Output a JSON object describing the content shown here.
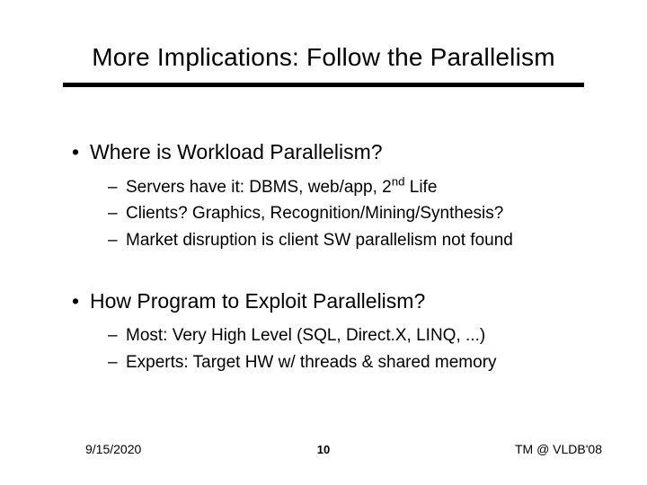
{
  "title": "More Implications: Follow the Parallelism",
  "bullets": [
    {
      "text": "Where is Workload Parallelism?",
      "sub": [
        {
          "pre": "Servers have it: DBMS, web/app, 2",
          "sup": "nd",
          "post": " Life"
        },
        {
          "pre": "Clients? Graphics, Recognition/Mining/Synthesis?",
          "sup": "",
          "post": ""
        },
        {
          "pre": "Market disruption is client SW parallelism not found",
          "sup": "",
          "post": ""
        }
      ]
    },
    {
      "text": "How Program to Exploit Parallelism?",
      "sub": [
        {
          "pre": "Most: Very High Level (SQL, Direct.X, LINQ, ...)",
          "sup": "",
          "post": ""
        },
        {
          "pre": "Experts: Target HW w/ threads & shared memory",
          "sup": "",
          "post": ""
        }
      ]
    }
  ],
  "footer": {
    "date": "9/15/2020",
    "page": "10",
    "right": "TM @ VLDB'08"
  }
}
